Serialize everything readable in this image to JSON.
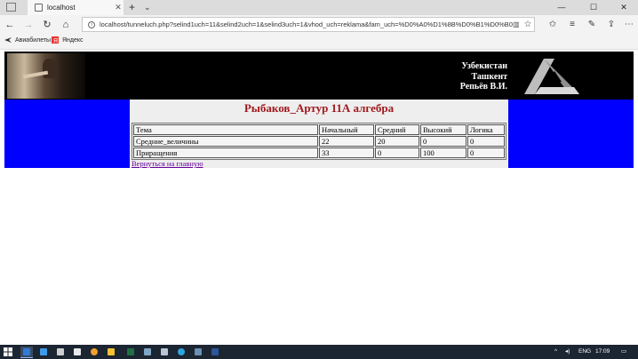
{
  "browser": {
    "tab_title": "localhost",
    "tab_close": "✕",
    "new_tab": "+",
    "tab_list": "⌄",
    "window": {
      "minimize": "—",
      "maximize": "☐",
      "close": "✕"
    },
    "nav": {
      "back": "←",
      "forward": "→",
      "refresh": "↻",
      "home": "⌂"
    },
    "url": "localhost/tunneluch.php?selind1uch=11&selind2uch=1&selind3uch=1&vhod_uch=reklama&fam_uch=%D0%A0%D1%8B%D0%B1%D0%B0%D0%BA%D0%",
    "favorites": [
      {
        "label": "Авиабилеты"
      },
      {
        "label": "Яндекс"
      }
    ]
  },
  "banner": {
    "lines": [
      "Узбекистан",
      "Ташкент",
      "Репьёв В.И."
    ]
  },
  "page": {
    "heading": "Рыбаков_Артур 11А алгебра",
    "table": {
      "headers": [
        "Тема",
        "Начальный",
        "Средний",
        "Высокий",
        "Логика"
      ],
      "rows": [
        [
          "Средние_величины",
          "22",
          "20",
          "0",
          "0"
        ],
        [
          "Приращения",
          "33",
          "0",
          "100",
          "0"
        ]
      ]
    },
    "back_link": "Вернуться на главную"
  },
  "taskbar": {
    "lang": "ENG",
    "time": "17:09"
  },
  "colors": {
    "side_band": "#0000ff",
    "heading": "#a0191e",
    "banner_bg": "#000000",
    "link": "#660099"
  }
}
